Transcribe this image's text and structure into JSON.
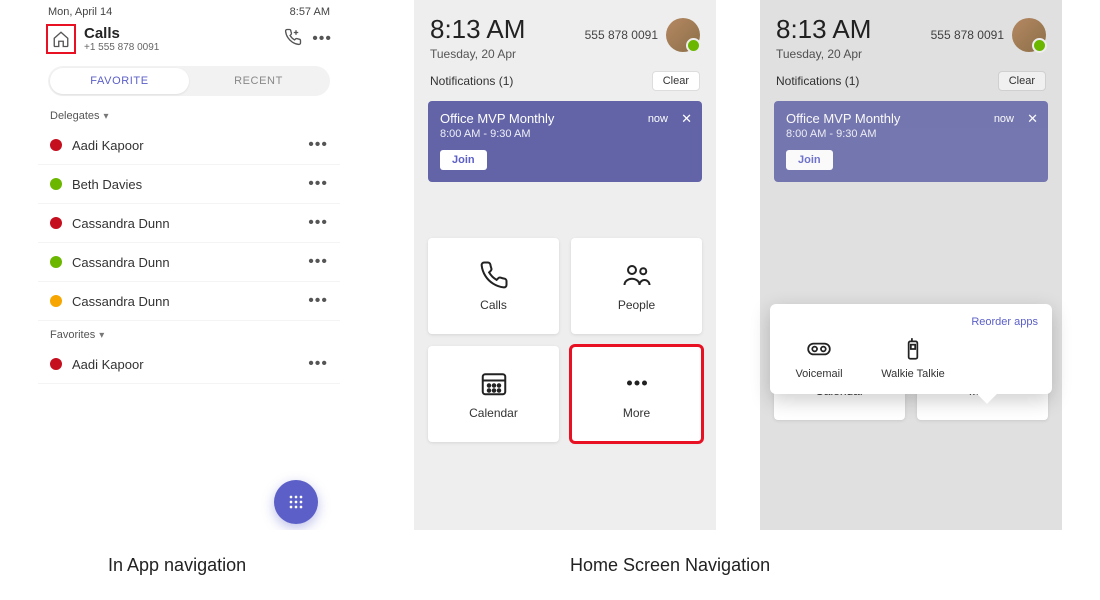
{
  "panel1": {
    "status_date": "Mon, April 14",
    "status_time": "8:57 AM",
    "title": "Calls",
    "phone": "+1 555 878 0091",
    "tabs": {
      "favorite": "FAVORITE",
      "recent": "RECENT"
    },
    "sections": {
      "delegates": "Delegates",
      "favorites": "Favorites"
    },
    "contacts_delegates": [
      {
        "name": "Aadi Kapoor",
        "presence": "#c50f1f"
      },
      {
        "name": "Beth Davies",
        "presence": "#6bb700"
      },
      {
        "name": "Cassandra Dunn",
        "presence": "#c50f1f"
      },
      {
        "name": "Cassandra Dunn",
        "presence": "#6bb700"
      },
      {
        "name": "Cassandra Dunn",
        "presence": "#f7a500"
      }
    ],
    "contacts_favorites": [
      {
        "name": "Aadi Kapoor",
        "presence": "#c50f1f"
      }
    ]
  },
  "home": {
    "time": "8:13 AM",
    "date": "Tuesday, 20 Apr",
    "phone": "555 878 0091",
    "notif_header": "Notifications (1)",
    "clear": "Clear",
    "notif": {
      "title": "Office MVP Monthly",
      "time": "8:00 AM - 9:30 AM",
      "tag": "now",
      "join": "Join"
    },
    "tiles": {
      "calls": "Calls",
      "people": "People",
      "calendar": "Calendar",
      "more": "More"
    },
    "popover": {
      "reorder": "Reorder apps",
      "voicemail": "Voicemail",
      "walkie": "Walkie Talkie"
    }
  },
  "captions": {
    "left": "In App navigation",
    "right": "Home Screen Navigation"
  }
}
